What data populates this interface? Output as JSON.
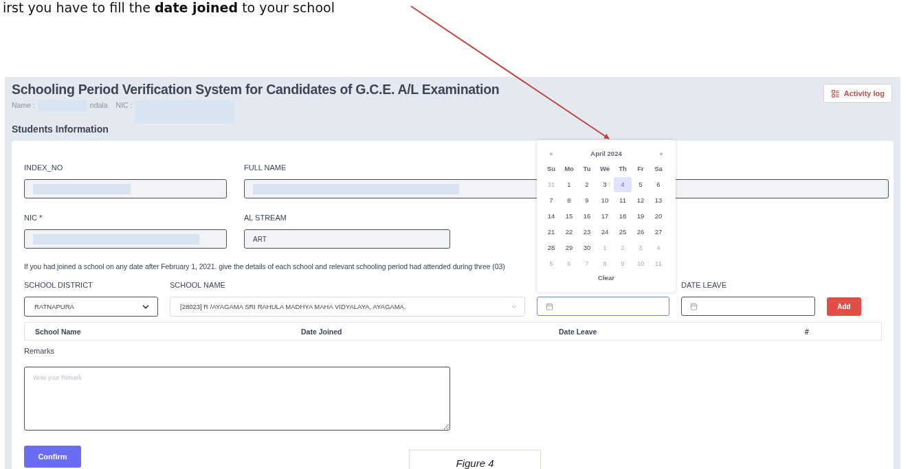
{
  "instruction": "irst you have to fill the **date joined** to your school",
  "header": {
    "title": "Schooling Period Verification System for Candidates of G.C.E. A/L Examination",
    "name_label": "Name :",
    "name_value": "ndala",
    "nic_label": "NIC :",
    "action": "Activity log"
  },
  "section_title": "Students Information",
  "index_no": {
    "label": "INDEX_NO"
  },
  "full_name": {
    "label": "FULL NAME"
  },
  "nic": {
    "label": "NIC *"
  },
  "al_stream": {
    "label": "AL STREAM",
    "value": "ART"
  },
  "note": "If you had joined a school on any date after February 1, 2021. give the details of each school and relevant schooling period had attended during three (03)",
  "school_district": {
    "label": "SCHOOL DISTRICT",
    "value": "RATNAPURA"
  },
  "school_name": {
    "label": "SCHOOL NAME",
    "value": "[28023] R /AYAGAMA SRI RAHULA MADHYA MAHA VIDYALAYA, AYAGAMA."
  },
  "date_joined": {
    "focused": true
  },
  "date_leave": {
    "label": "DATE LEAVE",
    "focused": false
  },
  "add_button": "Add",
  "table": {
    "columns": [
      "School Name",
      "Date Joined",
      "Date Leave",
      "#"
    ]
  },
  "remarks": {
    "label": "Remarks",
    "placeholder": "Write your Remark"
  },
  "confirm_button": "Confirm",
  "calendar": {
    "prev": "«",
    "title": "April 2024",
    "next": "»",
    "weekdays": [
      "Su",
      "Mo",
      "Tu",
      "We",
      "Th",
      "Fr",
      "Sa"
    ],
    "days": [
      {
        "label": "31",
        "outside": true,
        "selected": false
      },
      {
        "label": "1",
        "outside": false,
        "selected": false
      },
      {
        "label": "2",
        "outside": false,
        "selected": false
      },
      {
        "label": "3",
        "outside": false,
        "selected": false
      },
      {
        "label": "4",
        "outside": false,
        "selected": true
      },
      {
        "label": "5",
        "outside": false,
        "selected": false
      },
      {
        "label": "6",
        "outside": false,
        "selected": false
      },
      {
        "label": "7",
        "outside": false,
        "selected": false
      },
      {
        "label": "8",
        "outside": false,
        "selected": false
      },
      {
        "label": "9",
        "outside": false,
        "selected": false
      },
      {
        "label": "10",
        "outside": false,
        "selected": false
      },
      {
        "label": "11",
        "outside": false,
        "selected": false
      },
      {
        "label": "12",
        "outside": false,
        "selected": false
      },
      {
        "label": "13",
        "outside": false,
        "selected": false
      },
      {
        "label": "14",
        "outside": false,
        "selected": false
      },
      {
        "label": "15",
        "outside": false,
        "selected": false
      },
      {
        "label": "16",
        "outside": false,
        "selected": false
      },
      {
        "label": "17",
        "outside": false,
        "selected": false
      },
      {
        "label": "18",
        "outside": false,
        "selected": false
      },
      {
        "label": "19",
        "outside": false,
        "selected": false
      },
      {
        "label": "20",
        "outside": false,
        "selected": false
      },
      {
        "label": "21",
        "outside": false,
        "selected": false
      },
      {
        "label": "22",
        "outside": false,
        "selected": false
      },
      {
        "label": "23",
        "outside": false,
        "selected": false
      },
      {
        "label": "24",
        "outside": false,
        "selected": false
      },
      {
        "label": "25",
        "outside": false,
        "selected": false
      },
      {
        "label": "26",
        "outside": false,
        "selected": false
      },
      {
        "label": "27",
        "outside": false,
        "selected": false
      },
      {
        "label": "28",
        "outside": false,
        "selected": false
      },
      {
        "label": "29",
        "outside": false,
        "selected": false
      },
      {
        "label": "30",
        "outside": false,
        "selected": false
      },
      {
        "label": "1",
        "outside": true,
        "selected": false
      },
      {
        "label": "2",
        "outside": true,
        "selected": false
      },
      {
        "label": "3",
        "outside": true,
        "selected": false
      },
      {
        "label": "4",
        "outside": true,
        "selected": false
      },
      {
        "label": "5",
        "outside": true,
        "selected": false
      },
      {
        "label": "6",
        "outside": true,
        "selected": false
      },
      {
        "label": "7",
        "outside": true,
        "selected": false
      },
      {
        "label": "8",
        "outside": true,
        "selected": false
      },
      {
        "label": "9",
        "outside": true,
        "selected": false
      },
      {
        "label": "10",
        "outside": true,
        "selected": false
      },
      {
        "label": "11",
        "outside": true,
        "selected": false
      }
    ],
    "clear": "Clear"
  },
  "caption": "Figure 4"
}
